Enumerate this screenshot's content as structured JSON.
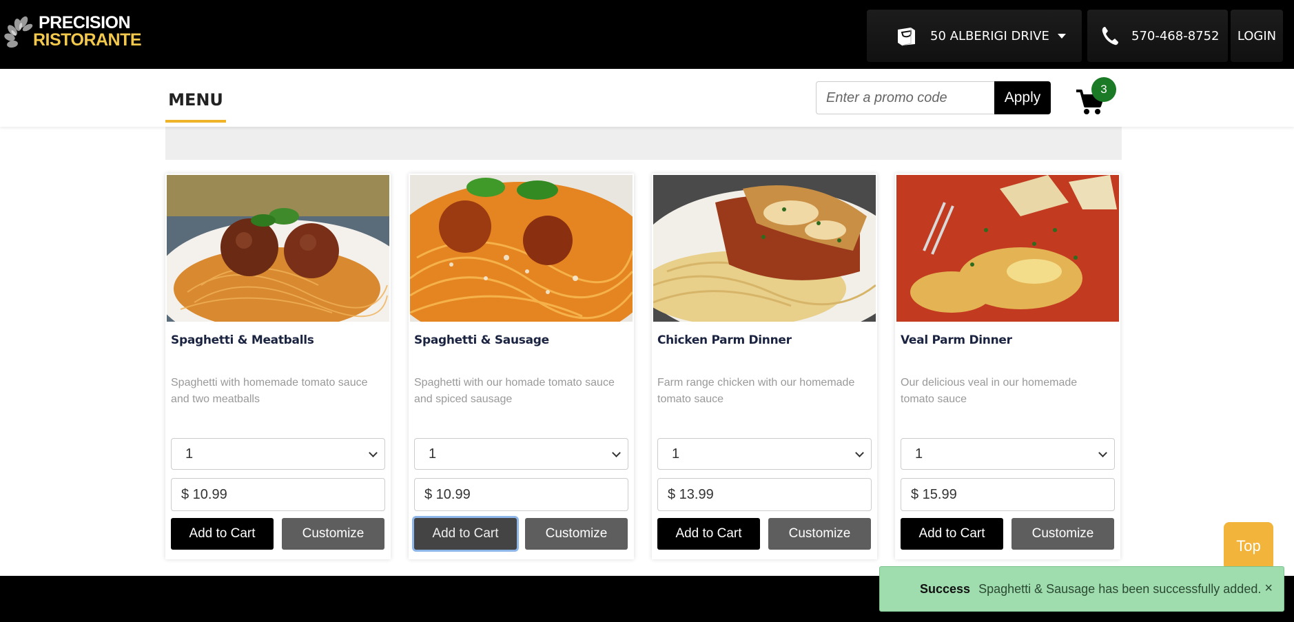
{
  "header": {
    "logo_line1": "PRECISION",
    "logo_line2": "RISTORANTE",
    "location_label": "50 ALBERIGI DRIVE",
    "phone_label": "570-468-8752",
    "login_label": "LOGIN"
  },
  "subnav": {
    "menu_tab_label": "MENU",
    "promo_placeholder": "Enter a promo code",
    "apply_label": "Apply",
    "cart_count": "3"
  },
  "products": [
    {
      "title": "Spaghetti & Meatballs",
      "description": "Spaghetti with homemade tomato sauce and two meatballs",
      "quantity": "1",
      "price": "$ 10.99",
      "add_label": "Add to Cart",
      "customize_label": "Customize"
    },
    {
      "title": "Spaghetti & Sausage",
      "description": "Spaghetti with our homade tomato sauce and spiced sausage",
      "quantity": "1",
      "price": "$ 10.99",
      "add_label": "Add to Cart",
      "customize_label": "Customize"
    },
    {
      "title": "Chicken Parm Dinner",
      "description": "Farm range chicken with our homemade tomato sauce",
      "quantity": "1",
      "price": "$ 13.99",
      "add_label": "Add to Cart",
      "customize_label": "Customize"
    },
    {
      "title": "Veal Parm Dinner",
      "description": "Our delicious veal in our homemade tomato sauce",
      "quantity": "1",
      "price": "$ 15.99",
      "add_label": "Add to Cart",
      "customize_label": "Customize"
    }
  ],
  "scroll_top_label": "Top",
  "toast": {
    "label": "Success",
    "message": "Spaghetti & Sausage has been successfully added.",
    "close": "×"
  },
  "colors": {
    "accent": "#f0b429",
    "badge": "#1b7a26",
    "toast_bg": "#9fdcae"
  }
}
